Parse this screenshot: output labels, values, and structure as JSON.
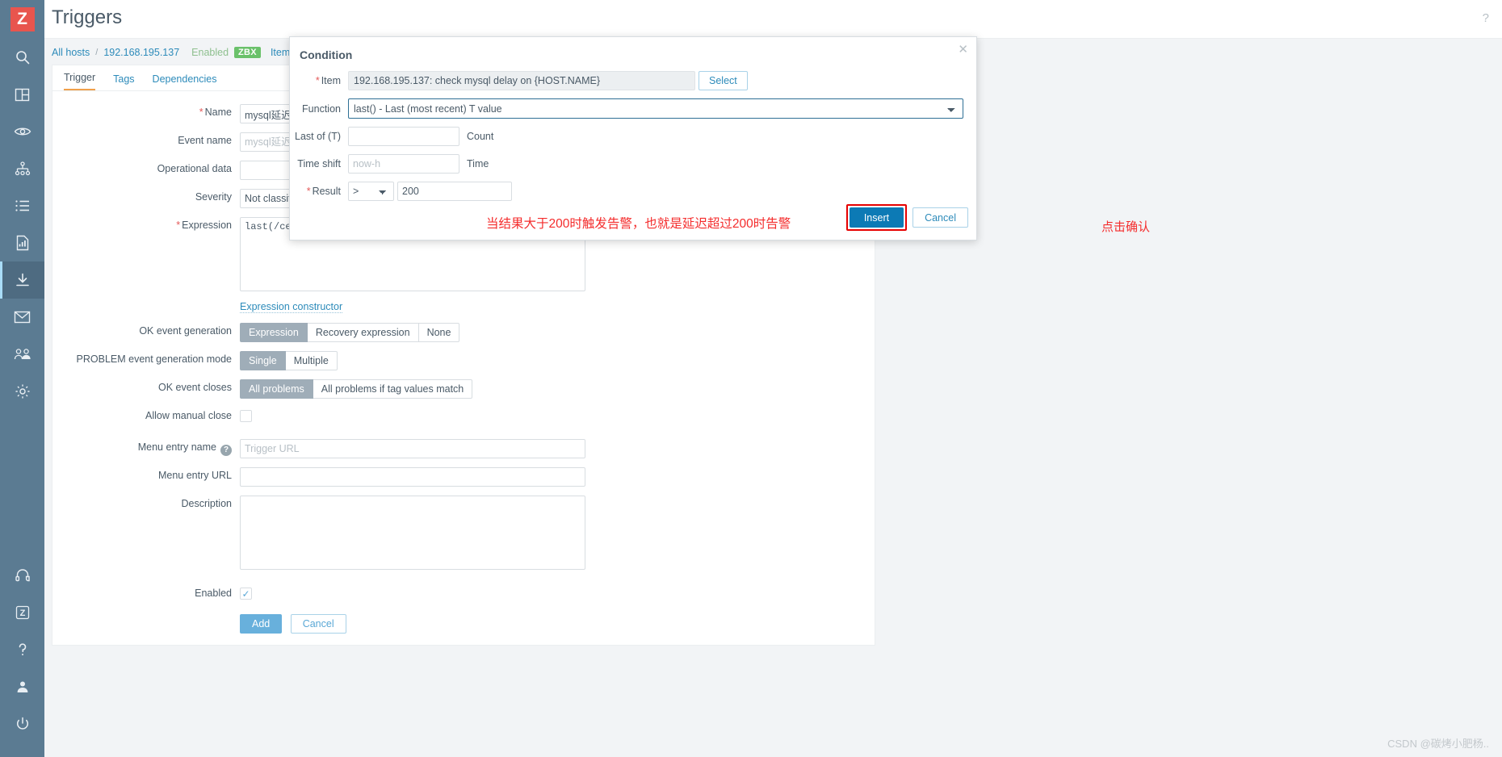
{
  "app": {
    "logo_letter": "Z",
    "page_title": "Triggers",
    "help_icon_label": "?"
  },
  "sidebar": {
    "items": [
      {
        "name": "search",
        "label": "Search"
      },
      {
        "name": "dashboards",
        "label": "Dashboards"
      },
      {
        "name": "monitoring",
        "label": "Monitoring"
      },
      {
        "name": "services",
        "label": "Services"
      },
      {
        "name": "inventory",
        "label": "Inventory"
      },
      {
        "name": "reports",
        "label": "Reports"
      },
      {
        "name": "data-collection",
        "label": "Data collection"
      },
      {
        "name": "alerts",
        "label": "Alerts"
      },
      {
        "name": "users",
        "label": "Users"
      },
      {
        "name": "administration",
        "label": "Administration"
      }
    ],
    "bottom_items": [
      {
        "name": "support",
        "label": "Support"
      },
      {
        "name": "integrations",
        "label": "Integrations"
      },
      {
        "name": "help",
        "label": "Help"
      },
      {
        "name": "user-settings",
        "label": "User settings"
      },
      {
        "name": "sign-out",
        "label": "Sign out"
      }
    ],
    "active_item": "data-collection"
  },
  "breadcrumb": {
    "all_hosts": "All hosts",
    "separator": "/",
    "host": "192.168.195.137",
    "status": "Enabled",
    "agent_badge": "ZBX",
    "items_link": "Items"
  },
  "tabs": [
    {
      "label": "Trigger",
      "active": true
    },
    {
      "label": "Tags",
      "active": false
    },
    {
      "label": "Dependencies",
      "active": false
    }
  ],
  "form": {
    "name": {
      "label": "Name",
      "required": true,
      "value": "mysql延迟"
    },
    "event_name": {
      "label": "Event name",
      "required": false,
      "value": "",
      "placeholder": "mysql延迟"
    },
    "operational_data": {
      "label": "Operational data",
      "required": false,
      "value": ""
    },
    "severity": {
      "label": "Severity",
      "required": false,
      "value": "Not classified"
    },
    "expression": {
      "label": "Expression",
      "required": true,
      "value": "last(/ce"
    },
    "expression_constructor": "Expression constructor",
    "ok_event_generation": {
      "label": "OK event generation",
      "options": [
        "Expression",
        "Recovery expression",
        "None"
      ],
      "selected": "Expression"
    },
    "problem_event_generation_mode": {
      "label": "PROBLEM event generation mode",
      "options": [
        "Single",
        "Multiple"
      ],
      "selected": "Single"
    },
    "ok_event_closes": {
      "label": "OK event closes",
      "options": [
        "All problems",
        "All problems if tag values match"
      ],
      "selected": "All problems"
    },
    "allow_manual_close": {
      "label": "Allow manual close",
      "checked": false
    },
    "menu_entry_name": {
      "label": "Menu entry name",
      "help": "?",
      "value": "",
      "placeholder": "Trigger URL"
    },
    "menu_entry_url": {
      "label": "Menu entry URL",
      "value": ""
    },
    "description": {
      "label": "Description",
      "value": ""
    },
    "enabled": {
      "label": "Enabled",
      "checked": true,
      "check_glyph": "✓"
    },
    "add_button": "Add",
    "cancel_button": "Cancel"
  },
  "modal": {
    "title": "Condition",
    "close_glyph": "✕",
    "item": {
      "label": "Item",
      "required": true,
      "value": "192.168.195.137: check mysql delay on {HOST.NAME}",
      "select_button": "Select"
    },
    "function": {
      "label": "Function",
      "value": "last() - Last (most recent) T value"
    },
    "last_of_t": {
      "label": "Last of (T)",
      "value": "",
      "unit": "Count"
    },
    "time_shift": {
      "label": "Time shift",
      "value": "",
      "placeholder": "now-h",
      "unit": "Time"
    },
    "result": {
      "label": "Result",
      "required": true,
      "operator": ">",
      "value": "200"
    },
    "insert_button": "Insert",
    "cancel_button": "Cancel"
  },
  "annotations": {
    "click_confirm": "点击确认",
    "explanation": "当结果大于200时触发告警，也就是延迟超过200时告警"
  },
  "watermark": "CSDN @碳烤小肥杨..",
  "colors": {
    "sidebar_bg": "#5b7b92",
    "logo_red": "#e8554e",
    "accent_blue": "#2d8bba",
    "insert_blue": "#0c7ab5",
    "annotation_red": "#f42c2c",
    "badge_green": "#6ac16a",
    "segment_selected": "#9fadb8",
    "tab_underline": "#f0a04b"
  }
}
